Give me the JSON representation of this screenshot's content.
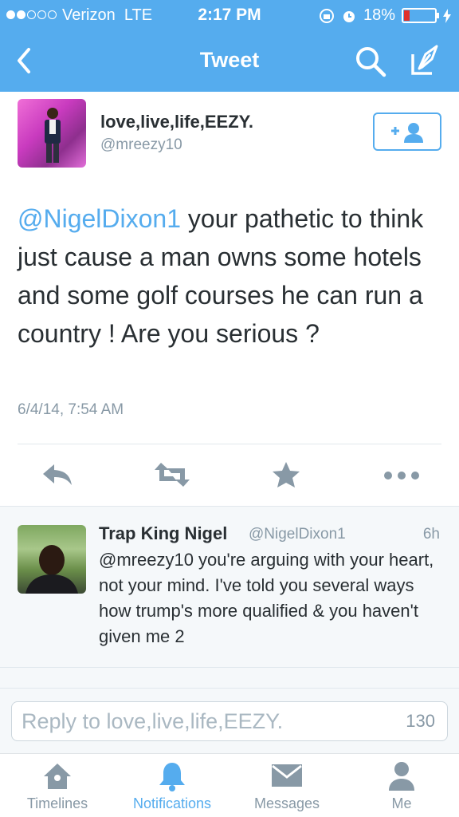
{
  "status_bar": {
    "carrier": "Verizon",
    "network": "LTE",
    "time": "2:17 PM",
    "battery_percent": "18%",
    "battery_level": 0.18,
    "signal_dots_filled": 2,
    "signal_dots_total": 5
  },
  "nav": {
    "title": "Tweet",
    "back_icon": "chevron-left-icon",
    "search_icon": "search-icon",
    "compose_icon": "compose-icon"
  },
  "author": {
    "name": "love,live,life,EEZY.",
    "handle": "@mreezy10",
    "follow_icon": "follow-user-icon"
  },
  "tweet": {
    "mention": "@NigelDixon1",
    "body": " your pathetic to think just cause a man owns some hotels and some golf courses he can run a country ! Are you serious ?",
    "date": "6/4/14, 7:54 AM"
  },
  "actions": {
    "reply_icon": "reply-icon",
    "retweet_icon": "retweet-icon",
    "favorite_icon": "star-icon",
    "more_icon": "more-icon"
  },
  "reply": {
    "name": "Trap King Nigel",
    "handle": "@NigelDixon1",
    "time": "6h",
    "text": "@mreezy10 you're arguing with your heart, not your mind. I've told you several ways how trump's more qualified & you haven't given me 2"
  },
  "composer": {
    "placeholder": "Reply to love,live,life,EEZY.",
    "char_count": "130"
  },
  "tabs": [
    {
      "label": "Timelines",
      "icon": "home-icon"
    },
    {
      "label": "Notifications",
      "icon": "bell-icon",
      "active": true
    },
    {
      "label": "Messages",
      "icon": "envelope-icon"
    },
    {
      "label": "Me",
      "icon": "person-icon"
    }
  ],
  "colors": {
    "brand": "#55acee",
    "text": "#292f33",
    "muted": "#8899a6",
    "battery_low": "#e0302b"
  }
}
